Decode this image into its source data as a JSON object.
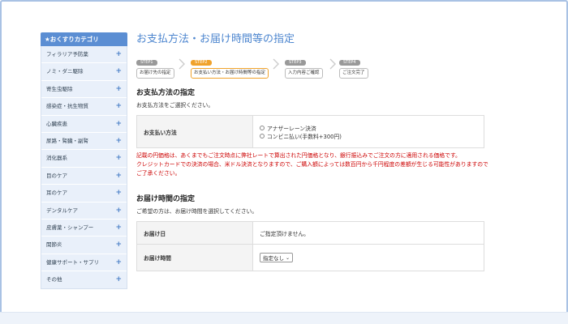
{
  "sidebar": {
    "title": "★おくすりカテゴリ",
    "items": [
      {
        "label": "フィラリア予防薬"
      },
      {
        "label": "ノミ・ダニ駆除"
      },
      {
        "label": "寄生虫駆除"
      },
      {
        "label": "感染症・抗生物質"
      },
      {
        "label": "心臓疾患"
      },
      {
        "label": "尿路・腎臓・副腎"
      },
      {
        "label": "消化器系"
      },
      {
        "label": "目のケア"
      },
      {
        "label": "耳のケア"
      },
      {
        "label": "デンタルケア"
      },
      {
        "label": "皮膚薬・シャンプー"
      },
      {
        "label": "関節炎"
      },
      {
        "label": "健康サポート・サプリ"
      },
      {
        "label": "その他"
      }
    ],
    "plus": "+"
  },
  "page_title": "お支払方法・お届け時間等の指定",
  "steps": [
    {
      "tag": "STEP1",
      "label": "お届け先の指定"
    },
    {
      "tag": "STEP2",
      "label": "お支払い方法・お届け時間等の指定"
    },
    {
      "tag": "STEP3",
      "label": "入力内容ご確認"
    },
    {
      "tag": "STEP4",
      "label": "ご注文完了"
    }
  ],
  "payment": {
    "title": "お支払方法の指定",
    "subtitle": "お支払方法をご選択ください。",
    "row_label": "お支払い方法",
    "options": [
      "アナザーレーン決済",
      "コンビニ払い(手数料+300円)"
    ],
    "notice_1": "記載の円価格は、あくまでもご注文時点に弊社レートで算出された円価格となり、銀行振込みでご注文の方に適用される価格です。",
    "notice_2": "クレジットカードでの決済の場合、米ドル決済となりますので、ご購入額によっては数百円から千円程度の差額が生じる可能性がありますのでご了承ください。"
  },
  "delivery": {
    "title": "お届け時間の指定",
    "subtitle": "ご希望の方は、お届け時間を選択してください。",
    "date_label": "お届け日",
    "date_value": "ご指定頂けません。",
    "time_label": "お届け時間",
    "time_selected": "指定なし"
  }
}
